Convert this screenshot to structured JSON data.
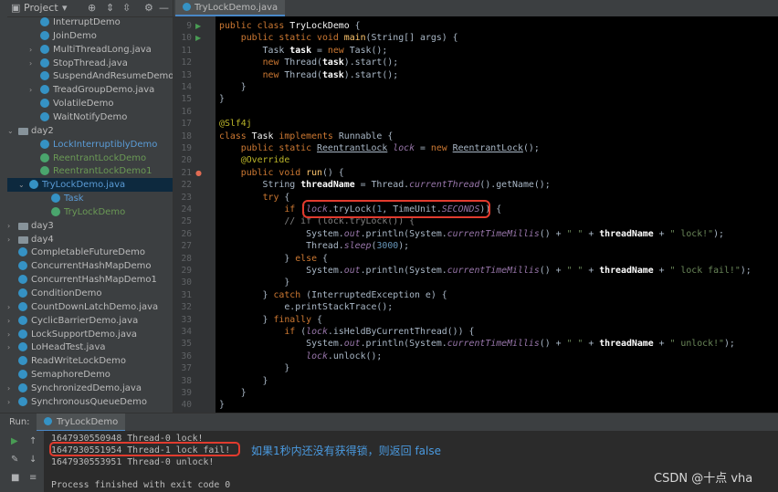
{
  "project_panel": {
    "title": "Project",
    "tree": [
      {
        "label": "InterruptDemo",
        "indent": 3,
        "icon": "class",
        "arrow": ""
      },
      {
        "label": "JoinDemo",
        "indent": 3,
        "icon": "class",
        "arrow": ""
      },
      {
        "label": "MultiThreadLong.java",
        "indent": 3,
        "icon": "class",
        "arrow": "›"
      },
      {
        "label": "StopThread.java",
        "indent": 3,
        "icon": "class",
        "arrow": "›"
      },
      {
        "label": "SuspendAndResumeDemo",
        "indent": 3,
        "icon": "class",
        "arrow": ""
      },
      {
        "label": "TreadGroupDemo.java",
        "indent": 3,
        "icon": "class",
        "arrow": "›"
      },
      {
        "label": "VolatileDemo",
        "indent": 3,
        "icon": "class",
        "arrow": ""
      },
      {
        "label": "WaitNotifyDemo",
        "indent": 3,
        "icon": "class",
        "arrow": ""
      },
      {
        "label": "day2",
        "indent": 1,
        "icon": "folder",
        "arrow": "⌄"
      },
      {
        "label": "LockInterruptiblyDemo",
        "indent": 3,
        "icon": "class",
        "arrow": "",
        "color": "blue"
      },
      {
        "label": "ReentrantLockDemo",
        "indent": 3,
        "icon": "class",
        "arrow": "",
        "color": "green"
      },
      {
        "label": "ReentrantLockDemo1",
        "indent": 3,
        "icon": "class",
        "arrow": "",
        "color": "green"
      },
      {
        "label": "TryLockDemo.java",
        "indent": 2,
        "icon": "class",
        "arrow": "⌄",
        "selected": true,
        "color": "blue"
      },
      {
        "label": "Task",
        "indent": 4,
        "icon": "class",
        "arrow": "",
        "color": "blue"
      },
      {
        "label": "TryLockDemo",
        "indent": 4,
        "icon": "class",
        "arrow": "",
        "color": "green"
      },
      {
        "label": "day3",
        "indent": 1,
        "icon": "folder",
        "arrow": "›"
      },
      {
        "label": "day4",
        "indent": 1,
        "icon": "folder",
        "arrow": "›"
      },
      {
        "label": "CompletableFutureDemo",
        "indent": 1,
        "icon": "class",
        "arrow": ""
      },
      {
        "label": "ConcurrentHashMapDemo",
        "indent": 1,
        "icon": "class",
        "arrow": ""
      },
      {
        "label": "ConcurrentHashMapDemo1",
        "indent": 1,
        "icon": "class",
        "arrow": ""
      },
      {
        "label": "ConditionDemo",
        "indent": 1,
        "icon": "class",
        "arrow": ""
      },
      {
        "label": "CountDownLatchDemo.java",
        "indent": 1,
        "icon": "class",
        "arrow": "›"
      },
      {
        "label": "CyclicBarrierDemo.java",
        "indent": 1,
        "icon": "class",
        "arrow": "›"
      },
      {
        "label": "LockSupportDemo.java",
        "indent": 1,
        "icon": "class",
        "arrow": "›"
      },
      {
        "label": "LoHeadTest.java",
        "indent": 1,
        "icon": "class",
        "arrow": "›"
      },
      {
        "label": "ReadWriteLockDemo",
        "indent": 1,
        "icon": "class",
        "arrow": ""
      },
      {
        "label": "SemaphoreDemo",
        "indent": 1,
        "icon": "class",
        "arrow": ""
      },
      {
        "label": "SynchronizedDemo.java",
        "indent": 1,
        "icon": "class",
        "arrow": "›"
      },
      {
        "label": "SynchronousQueueDemo",
        "indent": 1,
        "icon": "class",
        "arrow": "›"
      }
    ]
  },
  "editor": {
    "tab_label": "TryLockDemo.java",
    "lines": [
      {
        "n": "9",
        "run": true,
        "tokens": [
          [
            "kw",
            "public "
          ],
          [
            "kw",
            "class "
          ],
          [
            "ty",
            "TryLockDemo "
          ],
          [
            "",
            "{"
          ]
        ]
      },
      {
        "n": "10",
        "run": true,
        "tokens": [
          [
            "",
            "    "
          ],
          [
            "kw",
            "public static void "
          ],
          [
            "fn",
            "main"
          ],
          [
            "",
            "(String[] args) {"
          ]
        ]
      },
      {
        "n": "11",
        "tokens": [
          [
            "",
            "        Task "
          ],
          [
            "var",
            "task"
          ],
          [
            "",
            " = "
          ],
          [
            "kw",
            "new "
          ],
          [
            "",
            "Task();"
          ]
        ]
      },
      {
        "n": "12",
        "tokens": [
          [
            "",
            "        "
          ],
          [
            "kw",
            "new "
          ],
          [
            "",
            "Thread("
          ],
          [
            "var",
            "task"
          ],
          [
            "",
            ")."
          ],
          [
            "",
            "start();"
          ]
        ]
      },
      {
        "n": "13",
        "tokens": [
          [
            "",
            "        "
          ],
          [
            "kw",
            "new "
          ],
          [
            "",
            "Thread("
          ],
          [
            "var",
            "task"
          ],
          [
            "",
            ")."
          ],
          [
            "",
            "start();"
          ]
        ]
      },
      {
        "n": "14",
        "tokens": [
          [
            "",
            "    }"
          ]
        ]
      },
      {
        "n": "15",
        "tokens": [
          [
            "",
            "}"
          ]
        ]
      },
      {
        "n": "16",
        "tokens": []
      },
      {
        "n": "17",
        "tokens": [
          [
            "an",
            "@Slf4j"
          ]
        ]
      },
      {
        "n": "18",
        "tokens": [
          [
            "kw",
            "class "
          ],
          [
            "ty",
            "Task "
          ],
          [
            "kw",
            "implements "
          ],
          [
            "",
            "Runnable {"
          ]
        ]
      },
      {
        "n": "19",
        "tokens": [
          [
            "",
            "    "
          ],
          [
            "kw",
            "public static "
          ],
          [
            "ul",
            "ReentrantLock"
          ],
          [
            "",
            " "
          ],
          [
            "it",
            "lock"
          ],
          [
            "",
            " = "
          ],
          [
            "kw",
            "new "
          ],
          [
            "ul",
            "ReentrantLock"
          ],
          [
            "",
            "();"
          ]
        ]
      },
      {
        "n": "20",
        "tokens": [
          [
            "",
            "    "
          ],
          [
            "an",
            "@Override"
          ]
        ]
      },
      {
        "n": "21",
        "run": "o",
        "tokens": [
          [
            "",
            "    "
          ],
          [
            "kw",
            "public void "
          ],
          [
            "fn",
            "run"
          ],
          [
            "",
            "() {"
          ]
        ]
      },
      {
        "n": "22",
        "tokens": [
          [
            "",
            "        String "
          ],
          [
            "var",
            "threadName"
          ],
          [
            "",
            " = Thread."
          ],
          [
            "it",
            "currentThread"
          ],
          [
            "",
            "().getName();"
          ]
        ]
      },
      {
        "n": "23",
        "tokens": [
          [
            "",
            "        "
          ],
          [
            "kw",
            "try "
          ],
          [
            "",
            "{"
          ]
        ]
      },
      {
        "n": "24",
        "tokens": [
          [
            "",
            "            "
          ],
          [
            "kw",
            "if "
          ],
          [
            "",
            "("
          ],
          [
            "it",
            "lock"
          ],
          [
            "",
            ".tryLock("
          ],
          [
            "num",
            "1"
          ],
          [
            "",
            ", TimeUnit."
          ],
          [
            "it",
            "SECONDS"
          ],
          [
            "",
            ")) {"
          ]
        ]
      },
      {
        "n": "25",
        "tokens": [
          [
            "cm",
            "            // if (lock.tryLock()) {"
          ]
        ]
      },
      {
        "n": "26",
        "tokens": [
          [
            "",
            "                System."
          ],
          [
            "it",
            "out"
          ],
          [
            "",
            ".println(System."
          ],
          [
            "it",
            "currentTimeMillis"
          ],
          [
            "",
            "() + "
          ],
          [
            "str",
            "\" \""
          ],
          [
            "",
            " + "
          ],
          [
            "var",
            "threadName"
          ],
          [
            "",
            " + "
          ],
          [
            "str",
            "\" lock!\""
          ],
          [
            "",
            ");"
          ]
        ]
      },
      {
        "n": "27",
        "tokens": [
          [
            "",
            "                Thread."
          ],
          [
            "it",
            "sleep"
          ],
          [
            "",
            "("
          ],
          [
            "num",
            "3000"
          ],
          [
            "",
            ");"
          ]
        ]
      },
      {
        "n": "28",
        "tokens": [
          [
            "",
            "            } "
          ],
          [
            "kw",
            "else "
          ],
          [
            "",
            "{"
          ]
        ]
      },
      {
        "n": "29",
        "tokens": [
          [
            "",
            "                System."
          ],
          [
            "it",
            "out"
          ],
          [
            "",
            ".println(System."
          ],
          [
            "it",
            "currentTimeMillis"
          ],
          [
            "",
            "() + "
          ],
          [
            "str",
            "\" \""
          ],
          [
            "",
            " + "
          ],
          [
            "var",
            "threadName"
          ],
          [
            "",
            " + "
          ],
          [
            "str",
            "\" lock fail!\""
          ],
          [
            "",
            ");"
          ]
        ]
      },
      {
        "n": "30",
        "tokens": [
          [
            "",
            "            }"
          ]
        ]
      },
      {
        "n": "31",
        "tokens": [
          [
            "",
            "        } "
          ],
          [
            "kw",
            "catch "
          ],
          [
            "",
            "(InterruptedException e) {"
          ]
        ]
      },
      {
        "n": "32",
        "tokens": [
          [
            "",
            "            e.printStackTrace();"
          ]
        ]
      },
      {
        "n": "33",
        "tokens": [
          [
            "",
            "        } "
          ],
          [
            "kw",
            "finally "
          ],
          [
            "",
            "{"
          ]
        ]
      },
      {
        "n": "34",
        "tokens": [
          [
            "",
            "            "
          ],
          [
            "kw",
            "if "
          ],
          [
            "",
            "("
          ],
          [
            "it",
            "lock"
          ],
          [
            "",
            ".isHeldByCurrentThread()) {"
          ]
        ]
      },
      {
        "n": "35",
        "tokens": [
          [
            "",
            "                System."
          ],
          [
            "it",
            "out"
          ],
          [
            "",
            ".println(System."
          ],
          [
            "it",
            "currentTimeMillis"
          ],
          [
            "",
            "() + "
          ],
          [
            "str",
            "\" \""
          ],
          [
            "",
            " + "
          ],
          [
            "var",
            "threadName"
          ],
          [
            "",
            " + "
          ],
          [
            "str",
            "\" unlock!\""
          ],
          [
            "",
            ");"
          ]
        ]
      },
      {
        "n": "36",
        "tokens": [
          [
            "",
            "                "
          ],
          [
            "it",
            "lock"
          ],
          [
            "",
            ".unlock();"
          ]
        ]
      },
      {
        "n": "37",
        "tokens": [
          [
            "",
            "            }"
          ]
        ]
      },
      {
        "n": "38",
        "tokens": [
          [
            "",
            "        }"
          ]
        ]
      },
      {
        "n": "39",
        "tokens": [
          [
            "",
            "    }"
          ]
        ]
      },
      {
        "n": "40",
        "tokens": [
          [
            "",
            "}"
          ]
        ]
      }
    ]
  },
  "run_panel": {
    "label": "Run:",
    "tab_label": "TryLockDemo",
    "console": [
      "1647930550948 Thread-0 lock!",
      "1647930551954 Thread-1 lock fail!",
      "1647930553951 Thread-0 unlock!",
      "",
      "Process finished with exit code 0"
    ]
  },
  "annotation": "如果1秒内还没有获得锁，则返回 false",
  "watermark": "CSDN @十点 vha"
}
